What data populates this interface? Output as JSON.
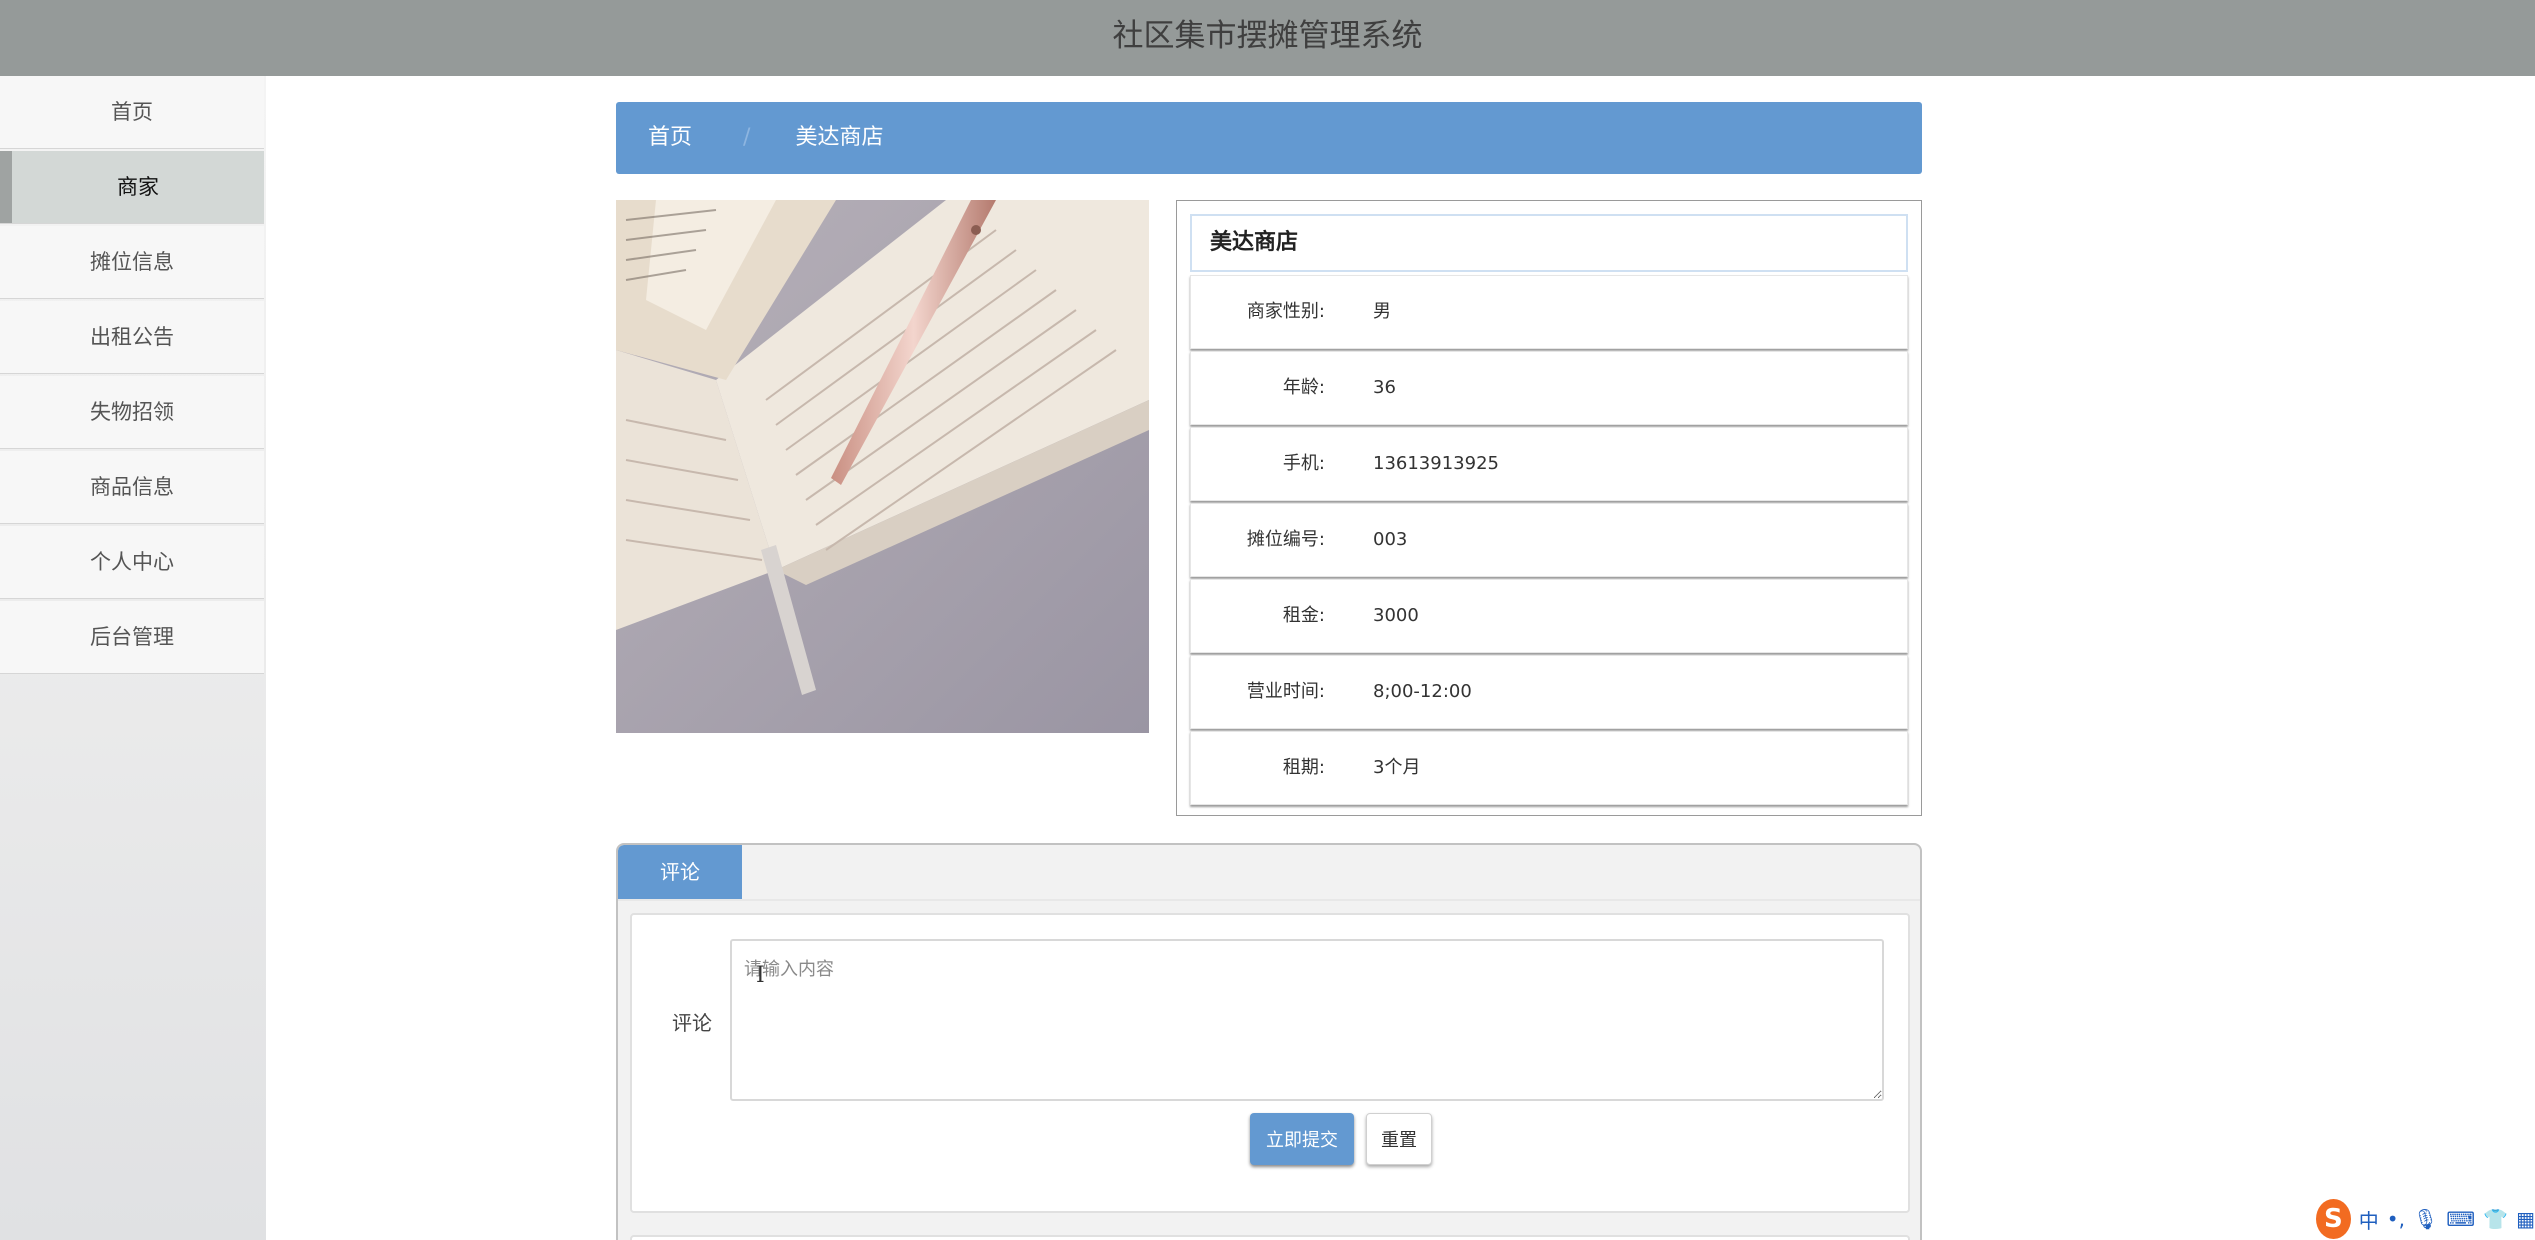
{
  "header": {
    "title": "社区集市摆摊管理系统"
  },
  "sidebar": {
    "items": [
      {
        "label": "首页",
        "active": false
      },
      {
        "label": "商家",
        "active": true
      },
      {
        "label": "摊位信息",
        "active": false
      },
      {
        "label": "出租公告",
        "active": false
      },
      {
        "label": "失物招领",
        "active": false
      },
      {
        "label": "商品信息",
        "active": false
      },
      {
        "label": "个人中心",
        "active": false
      },
      {
        "label": "后台管理",
        "active": false
      }
    ]
  },
  "breadcrumb": {
    "home": "首页",
    "separator": "/",
    "current": "美达商店"
  },
  "detail": {
    "name": "美达商店",
    "rows": [
      {
        "label": "商家性别:",
        "value": "男"
      },
      {
        "label": "年龄:",
        "value": "36"
      },
      {
        "label": "手机:",
        "value": "13613913925"
      },
      {
        "label": "摊位编号:",
        "value": "003"
      },
      {
        "label": "租金:",
        "value": "3000"
      },
      {
        "label": "营业时间:",
        "value": "8;00-12:00"
      },
      {
        "label": "租期:",
        "value": "3个月"
      }
    ]
  },
  "comments": {
    "tab_label": "评论",
    "field_label": "评论",
    "placeholder": "请输入内容",
    "submit_label": "立即提交",
    "reset_label": "重置"
  },
  "ime": {
    "logo": "S",
    "mode": "中",
    "punct": "•,",
    "icons": [
      "mic-icon",
      "keyboard-icon",
      "shirt-icon",
      "grid-icon"
    ]
  },
  "colors": {
    "accent": "#6399d1",
    "header_bg": "#959a99",
    "active_nav": "#d3d8d6"
  }
}
